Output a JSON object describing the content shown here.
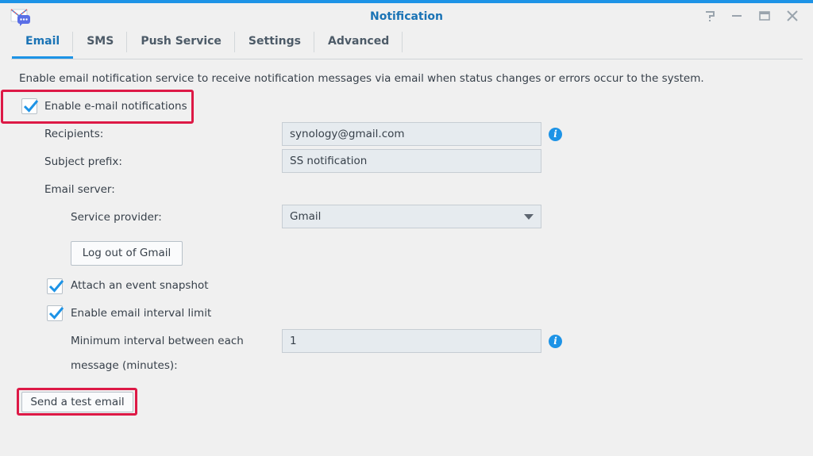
{
  "window": {
    "title": "Notification",
    "accent_color": "#1d93e6",
    "title_color": "#1a73b5",
    "controls": [
      "help-icon",
      "minimize-icon",
      "maximize-icon",
      "close-icon"
    ]
  },
  "tabs": [
    {
      "label": "Email",
      "active": true
    },
    {
      "label": "SMS",
      "active": false
    },
    {
      "label": "Push Service",
      "active": false
    },
    {
      "label": "Settings",
      "active": false
    },
    {
      "label": "Advanced",
      "active": false
    }
  ],
  "email": {
    "description": "Enable email notification service to receive notification messages via email when status changes or errors occur to the system.",
    "enable_label": "Enable e-mail notifications",
    "enable_checked": true,
    "recipients_label": "Recipients:",
    "recipients_value": "synology@gmail.com",
    "subject_label": "Subject prefix:",
    "subject_value": "SS notification",
    "server_label": "Email server:",
    "provider_label": "Service provider:",
    "provider_value": "Gmail",
    "logout_button": "Log out of Gmail",
    "snapshot_label": "Attach an event snapshot",
    "snapshot_checked": true,
    "interval_enable_label": "Enable email interval limit",
    "interval_enable_checked": true,
    "interval_label_line1": "Minimum interval between each",
    "interval_label_line2": "message (minutes):",
    "interval_value": "1",
    "test_button": "Send a test email"
  },
  "highlight_color": "#dd1946"
}
